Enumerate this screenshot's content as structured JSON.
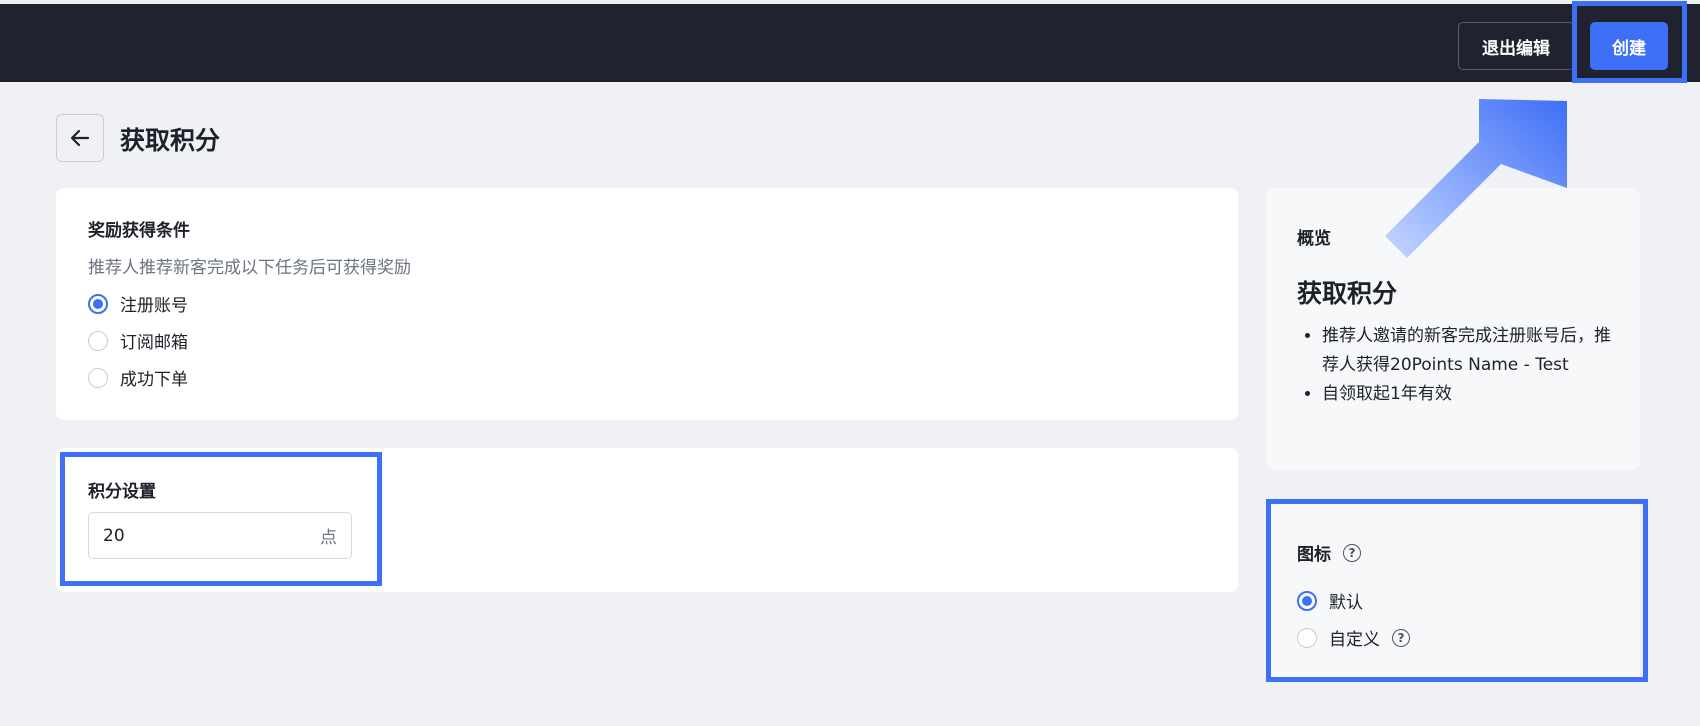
{
  "topbar": {
    "exit_label": "退出编辑",
    "create_label": "创建"
  },
  "header": {
    "title": "获取积分"
  },
  "conditions": {
    "title": "奖励获得条件",
    "desc": "推荐人推荐新客完成以下任务后可获得奖励",
    "options": [
      {
        "label": "注册账号",
        "checked": true
      },
      {
        "label": "订阅邮箱",
        "checked": false
      },
      {
        "label": "成功下单",
        "checked": false
      }
    ]
  },
  "points": {
    "title": "积分设置",
    "value": "20",
    "unit": "点"
  },
  "overview": {
    "title": "概览",
    "subtitle": "获取积分",
    "items": [
      "推荐人邀请的新客完成注册账号后，推荐人获得20Points Name - Test",
      "自领取起1年有效"
    ]
  },
  "icon_setting": {
    "title": "图标",
    "options": [
      {
        "label": "默认",
        "checked": true
      },
      {
        "label": "自定义",
        "checked": false
      }
    ]
  },
  "colors": {
    "accent": "#3d6ff7",
    "topbar": "#20232f",
    "background": "#f0f1f5"
  }
}
